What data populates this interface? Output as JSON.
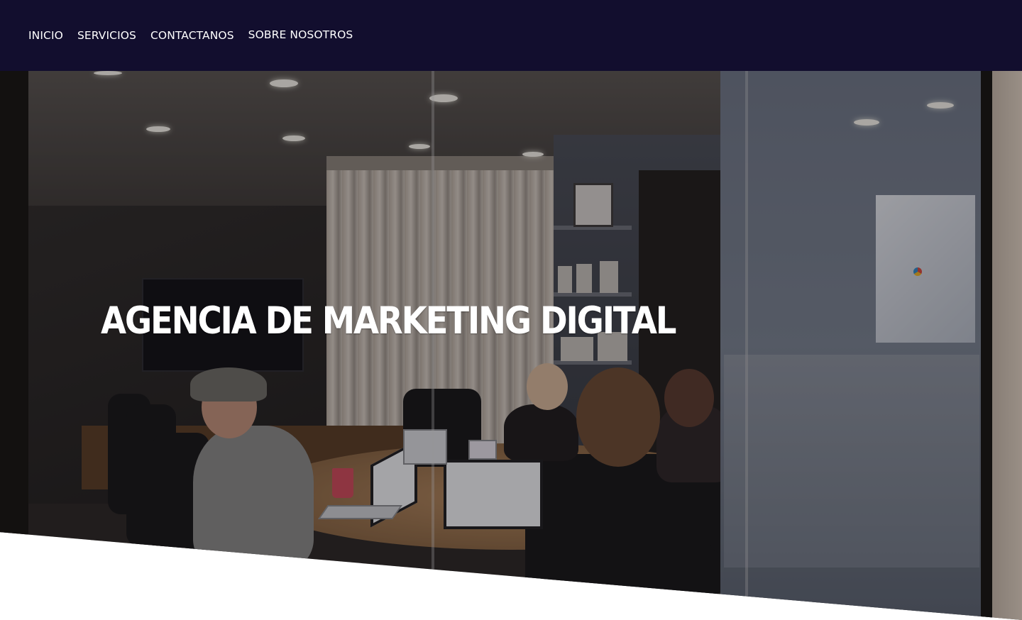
{
  "nav": {
    "items": [
      {
        "label": "INICIO"
      },
      {
        "label": "SERVICIOS"
      },
      {
        "label": "CONTACTANOS"
      },
      {
        "label": "SOBRE NOSOTROS"
      }
    ]
  },
  "hero": {
    "title": "AGENCIA DE MARKETING DIGITAL",
    "background_image": "office-meeting-photo"
  },
  "colors": {
    "navbar_bg": "#120e2e",
    "nav_text": "#ffffff",
    "hero_text": "#ffffff",
    "page_bg": "#ffffff"
  }
}
